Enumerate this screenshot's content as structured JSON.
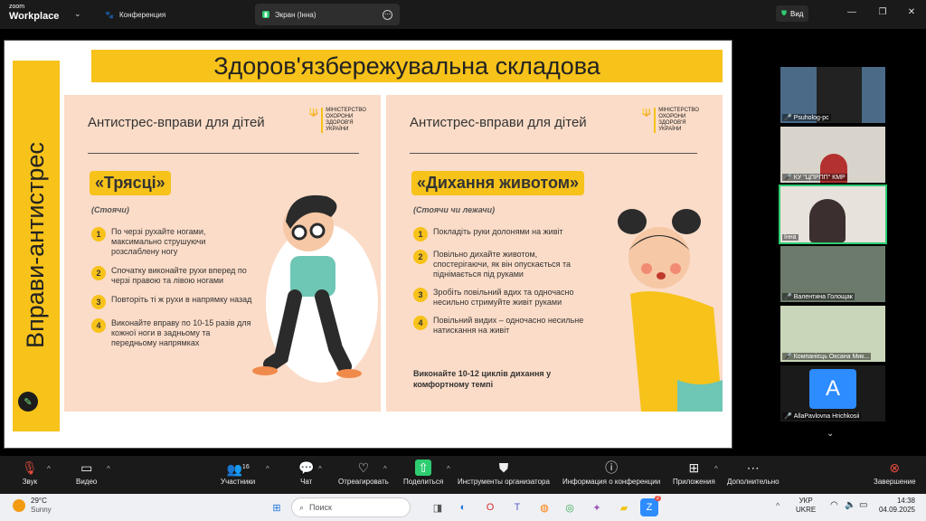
{
  "app": {
    "logo_top": "zoom",
    "logo_bottom": "Workplace"
  },
  "tabs": [
    {
      "label": "Конференция"
    },
    {
      "label": "Экран (Інна)"
    }
  ],
  "view_label": "Вид",
  "slide": {
    "banner": "Здоров'язбережувальна складова",
    "sidebar_title": "Вправи-антистрес",
    "ministry": [
      "МІНІСТЕРСТВО",
      "ОХОРОНИ",
      "ЗДОРОВ'Я",
      "УКРАЇНИ"
    ],
    "left_card": {
      "title": "Антистрес-вправи для дітей",
      "exercise": "«Трясці»",
      "subtitle": "(Стоячи)",
      "steps": [
        {
          "n": "1",
          "text": "По черзі рухайте ногами, максимально струшуючи розслаблену ногу"
        },
        {
          "n": "2",
          "text": "Спочатку виконайте рухи вперед по черзі правою та лівою ногами"
        },
        {
          "n": "3",
          "text": "Повторіть ті ж рухи в напрямку назад"
        },
        {
          "n": "4",
          "text": "Виконайте вправу по 10-15 разів для кожної ноги в задньому та передньому напрямках"
        }
      ]
    },
    "right_card": {
      "title": "Антистрес-вправи для дітей",
      "exercise": "«Дихання животом»",
      "subtitle": "(Стоячи чи лежачи)",
      "steps": [
        {
          "n": "1",
          "text": "Покладіть руки долонями на живіт"
        },
        {
          "n": "2",
          "text": "Повільно дихайте животом, спостерігаючи, як він опускається та піднімається під руками"
        },
        {
          "n": "3",
          "text": "Зробіть повільний вдих та одночасно несильно стримуйте живіт руками"
        },
        {
          "n": "4",
          "text": "Повільний видих – одночасно несильне натискання на живіт"
        }
      ],
      "note": "Виконайте 10-12 циклів дихання у комфортному темпі"
    }
  },
  "participants": [
    {
      "name": "Psuholog-pc"
    },
    {
      "name": "КУ \"ЦПРПП\" КМР"
    },
    {
      "name": "Інна"
    },
    {
      "name": "Валентина Голощак"
    },
    {
      "name": "Компанієць Оксана Мик..."
    },
    {
      "name": "AllaPavlovna Hrichkosii",
      "initial": "A"
    }
  ],
  "toolbar": {
    "audio": "Звук",
    "video": "Видео",
    "participants": "Участники",
    "participants_count": "16",
    "chat": "Чат",
    "react": "Отреагировать",
    "share": "Поделиться",
    "host_tools": "Инструменты организатора",
    "info": "Информация о конференции",
    "apps": "Приложения",
    "more": "Дополнительно",
    "end": "Завершение"
  },
  "taskbar": {
    "temp": "29°C",
    "weather": "Sunny",
    "search_placeholder": "Поиск",
    "lang1": "УКР",
    "lang2": "UKRE",
    "time": "14:38",
    "date": "04.09.2025",
    "badge": "2"
  }
}
